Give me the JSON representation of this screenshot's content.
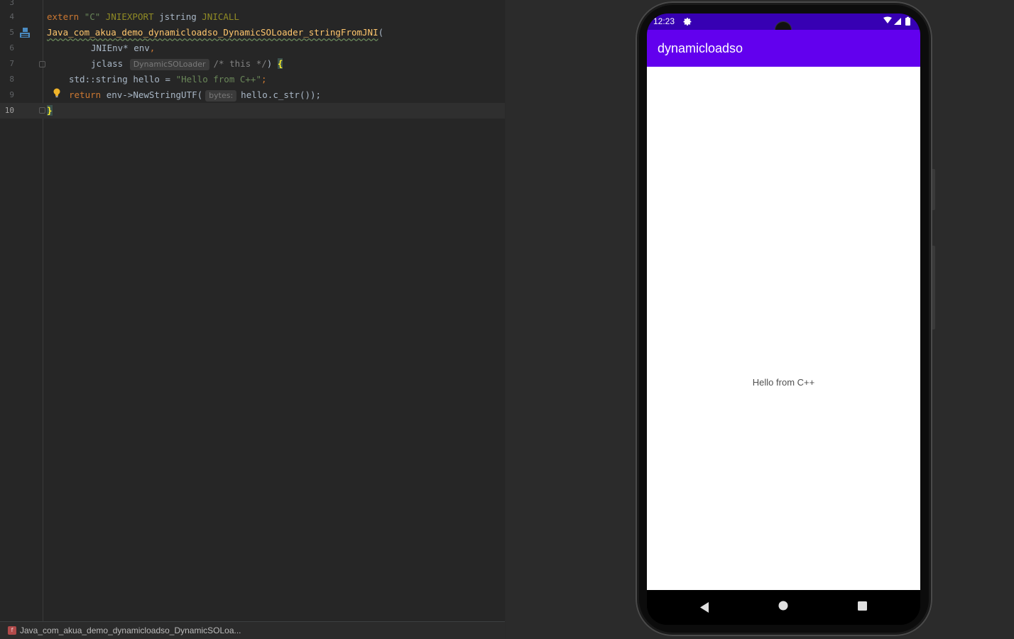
{
  "ide": {
    "lines": [
      {
        "number": "3"
      },
      {
        "number": "4"
      },
      {
        "number": "5"
      },
      {
        "number": "6"
      },
      {
        "number": "7"
      },
      {
        "number": "8"
      },
      {
        "number": "9"
      },
      {
        "number": "10"
      }
    ],
    "code": {
      "l4_extern": "extern",
      "l4_c": "\"C\"",
      "l4_jniexport": "JNIEXPORT",
      "l4_jstring": "jstring",
      "l4_jnicall": "JNICALL",
      "l5_fn": "Java_com_akua_demo_dynamicloadso_DynamicSOLoader_stringFromJNI",
      "l5_paren": "(",
      "l6_type": "JNIEnv*",
      "l6_name": "env",
      "l6_comma": ",",
      "l7_type": "jclass",
      "l7_hint": "DynamicSOLoader",
      "l7_comment": "/* this */",
      "l7_paren": ")",
      "l7_brace": "{",
      "l8_type": "std::string",
      "l8_var": "hello",
      "l8_eq": "=",
      "l8_str": "\"Hello from C++\"",
      "l8_semi": ";",
      "l9_return": "return",
      "l9_call": "env->NewStringUTF(",
      "l9_hint": "bytes:",
      "l9_arg": "hello.c_str());",
      "l10_brace": "}"
    },
    "status_file_icon": "f",
    "status_text": "Java_com_akua_demo_dynamicloadso_DynamicSOLoa..."
  },
  "phone": {
    "time": "12:23",
    "app_title": "dynamicloadso",
    "hello_text": "Hello from C++",
    "icons": {
      "settings": "gear-icon",
      "wifi": "wifi-icon",
      "signal": "signal-icon",
      "battery": "battery-icon",
      "camera": "front-camera",
      "back": "back-triangle-icon",
      "home": "home-circle-icon",
      "recents": "recents-square-icon"
    },
    "colors": {
      "status_bar": "#3700b3",
      "app_bar": "#6200ee",
      "content_bg": "#ffffff"
    }
  }
}
